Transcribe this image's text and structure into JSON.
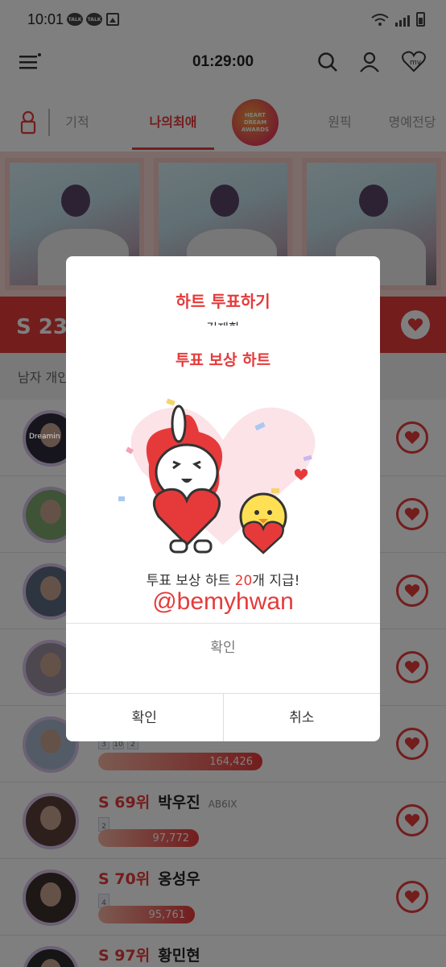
{
  "status_bar": {
    "time": "10:01",
    "talk_badge_1": "TALK",
    "talk_badge_2": "TALK"
  },
  "header": {
    "timer": "01:29:00",
    "icons": [
      "menu-icon",
      "search-icon",
      "profile-icon",
      "my-heart-icon"
    ],
    "my_label": "my"
  },
  "tabs": [
    {
      "label": "기적",
      "active": false
    },
    {
      "label": "나의최애",
      "active": true
    },
    {
      "label": "원픽",
      "active": false
    },
    {
      "label": "명예전당",
      "active": false
    }
  ],
  "award_logo": {
    "line1": "HEART",
    "line2": "DREAM",
    "line3": "AWARDS"
  },
  "rank_strip": {
    "text": "S 23위"
  },
  "subhead": {
    "text": "남자 개인"
  },
  "list": [
    {
      "rank": "",
      "name": "",
      "group": "",
      "votes": "",
      "avatar_text": "Dreamin"
    },
    {
      "rank": "",
      "name": "",
      "group": "",
      "votes": ""
    },
    {
      "rank": "",
      "name": "",
      "group": "",
      "votes": ""
    },
    {
      "rank": "",
      "name": "",
      "group": "",
      "votes": ""
    },
    {
      "rank": "",
      "name": "",
      "group": "",
      "votes": "164,426",
      "badges": [
        "3",
        "10",
        "2"
      ],
      "fill": 0.85
    },
    {
      "rank": "S 69위",
      "name": "박우진",
      "group": "AB6IX",
      "votes": "97,772",
      "badges": [
        "2"
      ],
      "fill": 0.52
    },
    {
      "rank": "S 70위",
      "name": "옹성우",
      "group": "",
      "votes": "95,761",
      "badges": [
        "4"
      ],
      "fill": 0.5
    },
    {
      "rank": "S 97위",
      "name": "황민현",
      "group": "",
      "votes": ""
    }
  ],
  "vote_dialog": {
    "title": "하트 투표하기",
    "name": "김재환",
    "confirm": "확인",
    "cancel": "취소"
  },
  "reward_dialog": {
    "title": "투표 보상 하트",
    "message_prefix": "투표 보상 하트 ",
    "message_count": "20",
    "message_suffix": "개 지급!",
    "handle": "@bemyhwan",
    "confirm": "확인"
  },
  "colors": {
    "accent": "#e63a3a",
    "dim": "rgba(0,0,0,0.5)"
  }
}
